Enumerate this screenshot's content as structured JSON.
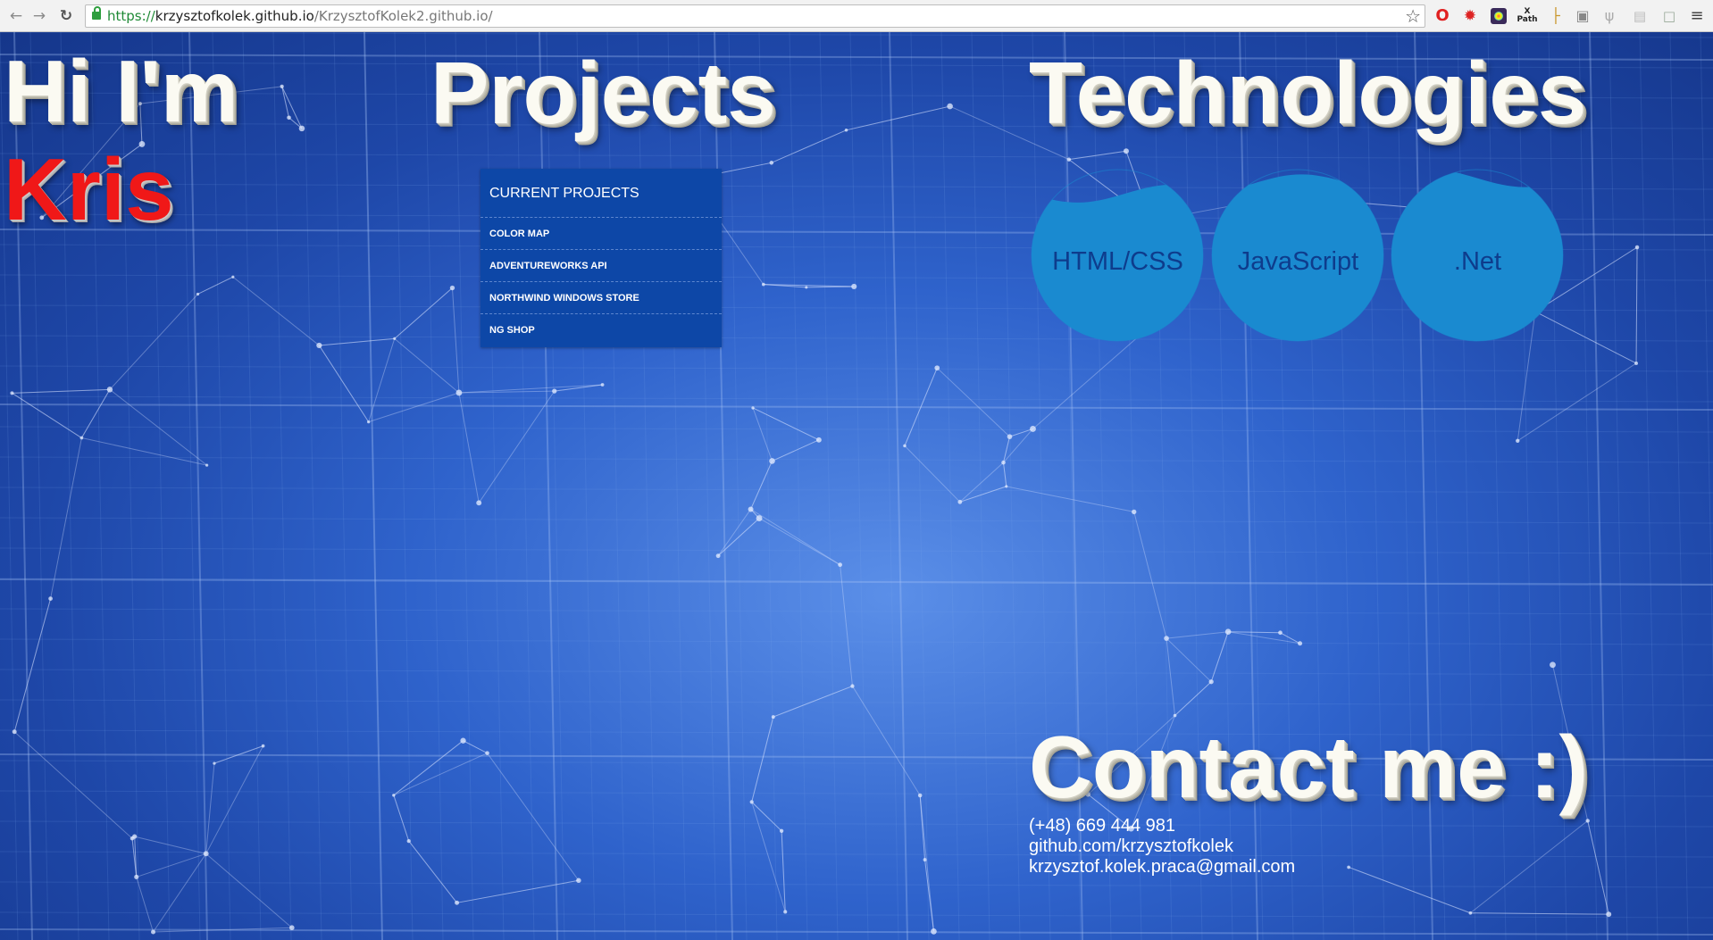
{
  "browser": {
    "url_scheme": "https://",
    "url_host": "krzysztofkolek.github.io",
    "url_path": "/KrzysztofKolek2.github.io/",
    "icons": {
      "back": "back-arrow-icon",
      "forward": "forward-arrow-icon",
      "reload": "reload-icon",
      "secure": "lock-icon",
      "bookmark": "star-icon",
      "menu": "hamburger-menu-icon"
    },
    "extensions": {
      "xpath_top": "X",
      "xpath_bottom": "Path"
    }
  },
  "intro": {
    "greeting": "Hi I'm",
    "name": "Kris",
    "name_color": "#f01818"
  },
  "projects": {
    "heading": "Projects",
    "panel_title": "CURRENT PROJECTS",
    "items": [
      "COLOR MAP",
      "ADVENTUREWORKS API",
      "NORTHWIND WINDOWS STORE",
      "NG SHOP"
    ],
    "panel_color": "#0d47a7"
  },
  "technologies": {
    "heading": "Technologies",
    "items": [
      "HTML/CSS",
      "JavaScript",
      ".Net"
    ],
    "fill_levels": [
      0.86,
      0.92,
      0.95
    ],
    "bubble_color": "#1a8ad0"
  },
  "contact": {
    "heading": "Contact me :)",
    "phone": "(+48) 669 444 981",
    "github": "github.com/krzysztofkolek",
    "email": "krzysztof.kolek.praca@gmail.com"
  }
}
